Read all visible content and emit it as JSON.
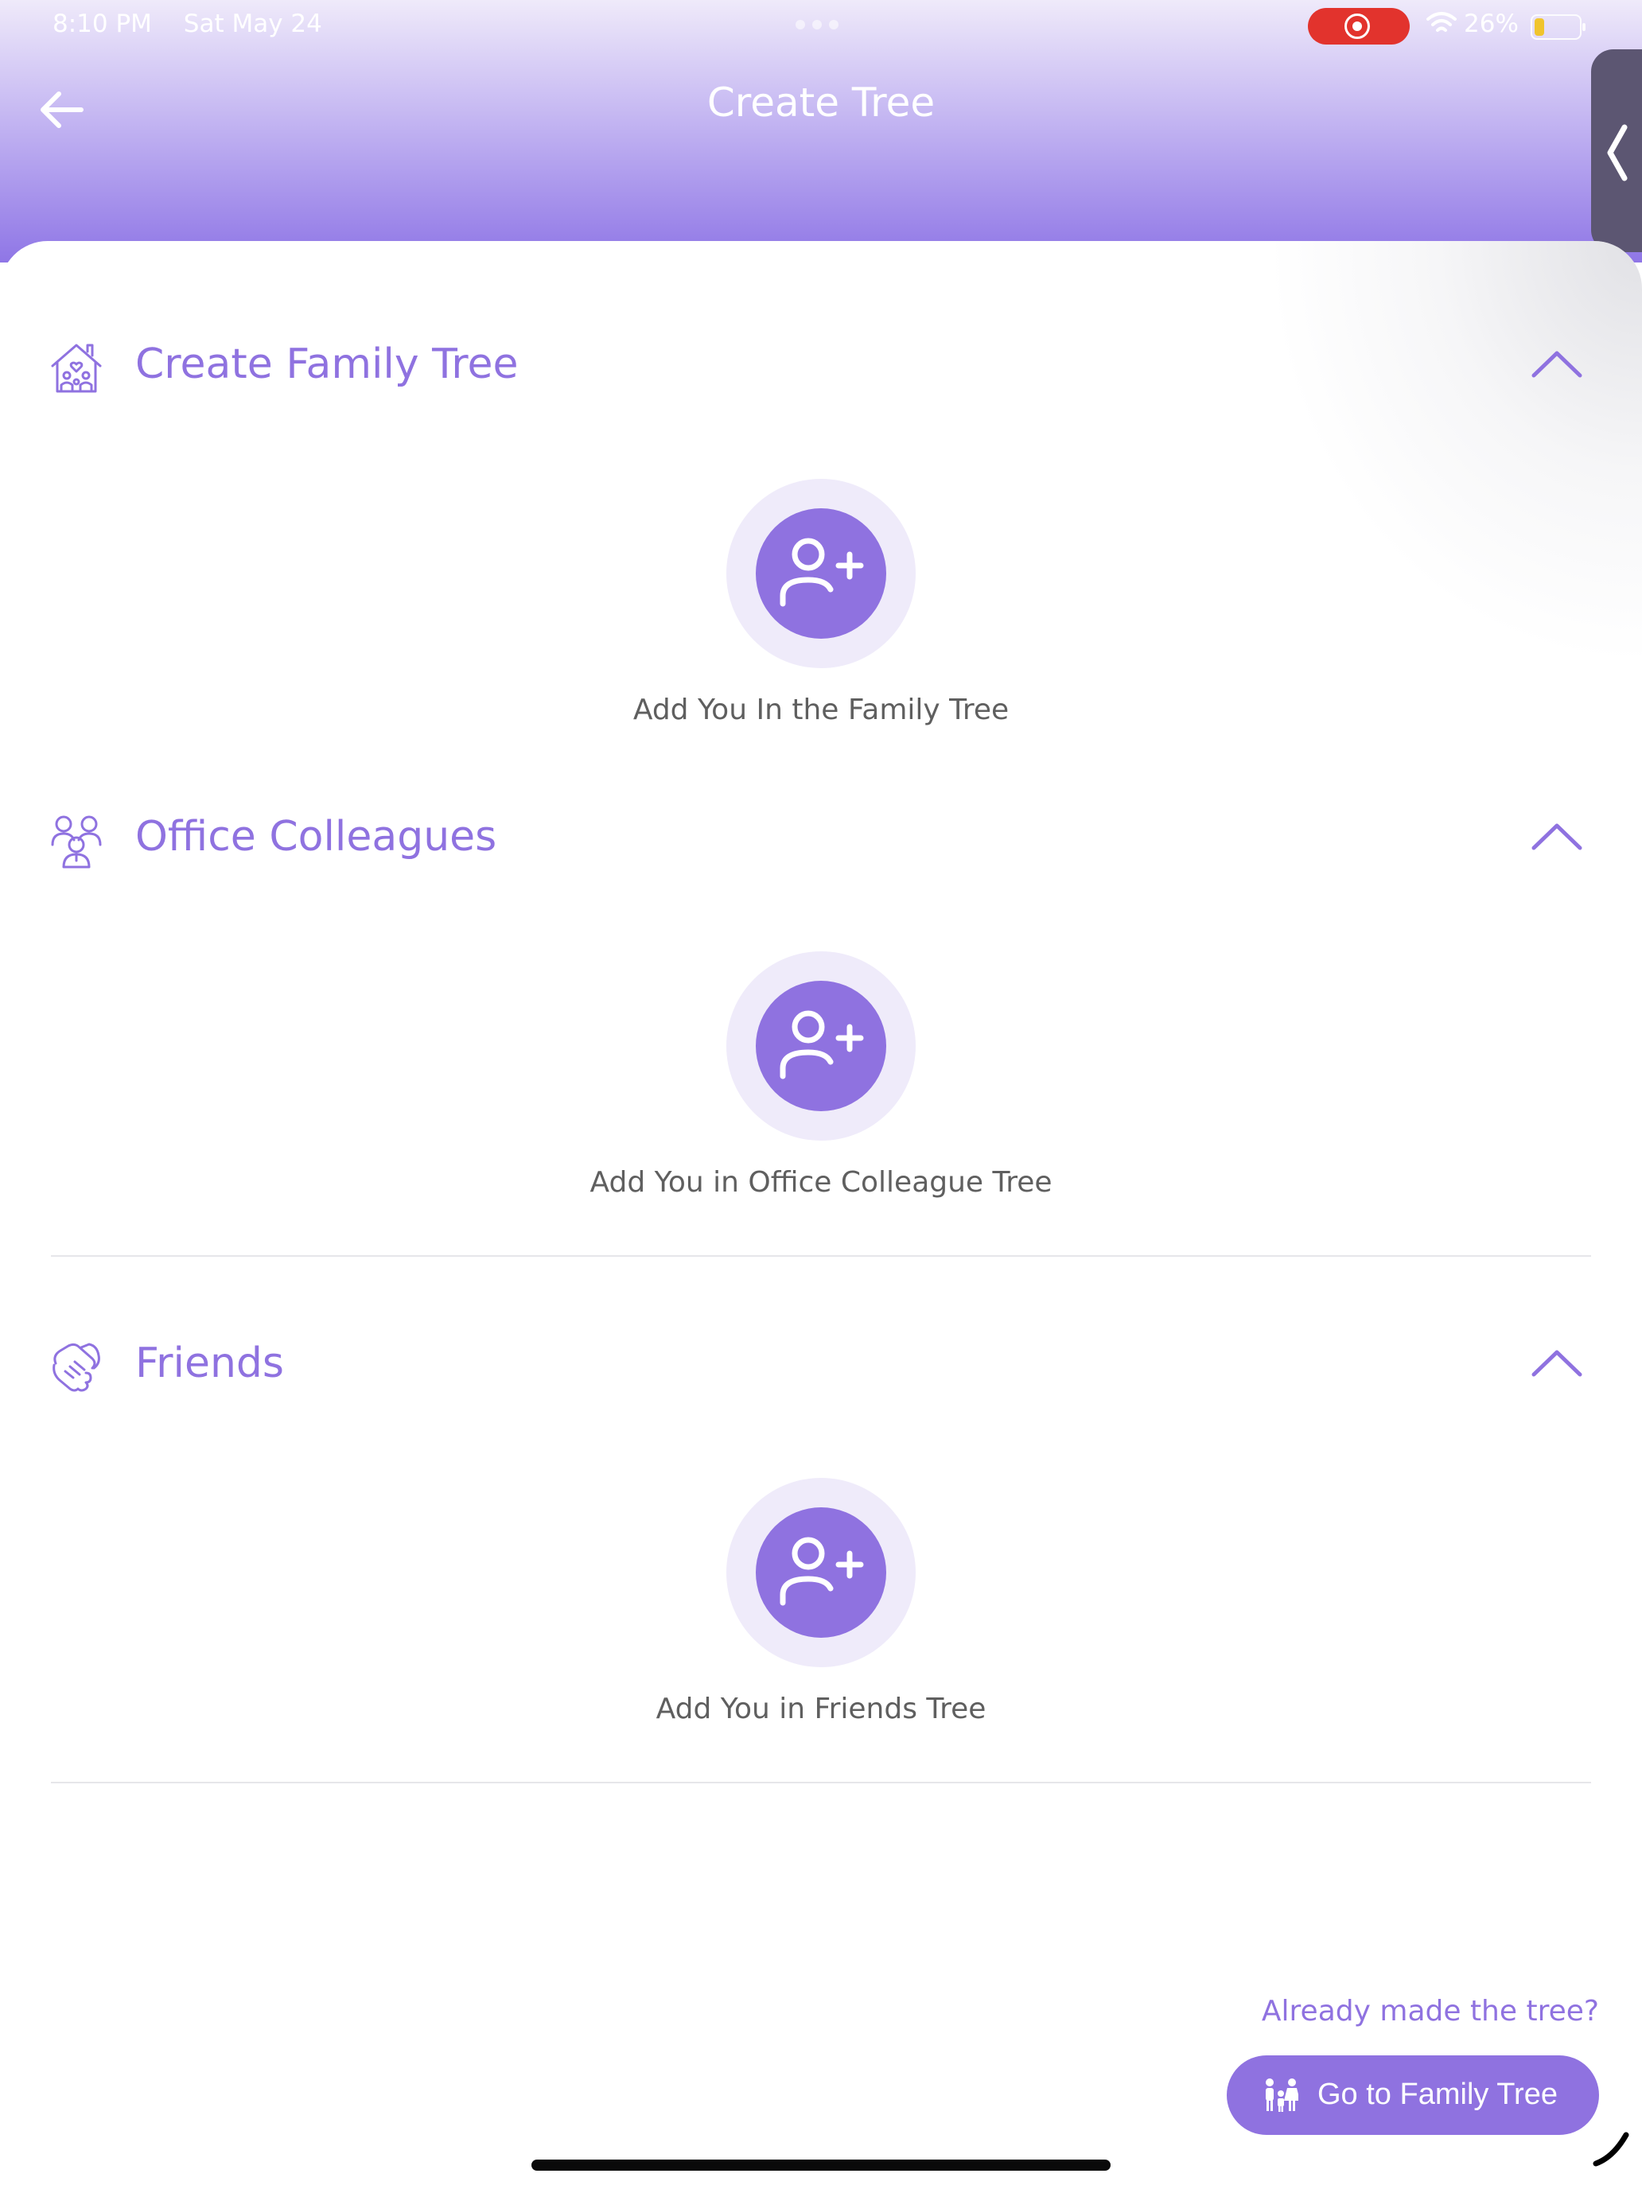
{
  "status_bar": {
    "time": "8:10 PM",
    "date": "Sat May 24",
    "battery": "26%",
    "icons": [
      "screen-record-icon",
      "wifi-icon",
      "battery-icon"
    ]
  },
  "header": {
    "title": "Create Tree",
    "back_icon": "arrow-left-icon",
    "side_tab_icon": "chevron-left-icon"
  },
  "sections": [
    {
      "title": "Create Family Tree",
      "icon": "family-house-icon",
      "add_label": "Add You In the Family Tree"
    },
    {
      "title": "Office Colleagues",
      "icon": "colleagues-icon",
      "add_label": "Add You in Office Colleague Tree"
    },
    {
      "title": "Friends",
      "icon": "handshake-icon",
      "add_label": "Add You in Friends Tree"
    }
  ],
  "footer": {
    "prompt": "Already made the tree?",
    "button_label": "Go to Family Tree",
    "button_icon": "family-icon"
  },
  "colors": {
    "accent": "#8f72e0",
    "accent_light": "#efebfa",
    "header_top": "#efeafa",
    "header_bottom": "#8f76e6",
    "text_gray": "#5f5f5f",
    "record": "#e2332d"
  }
}
